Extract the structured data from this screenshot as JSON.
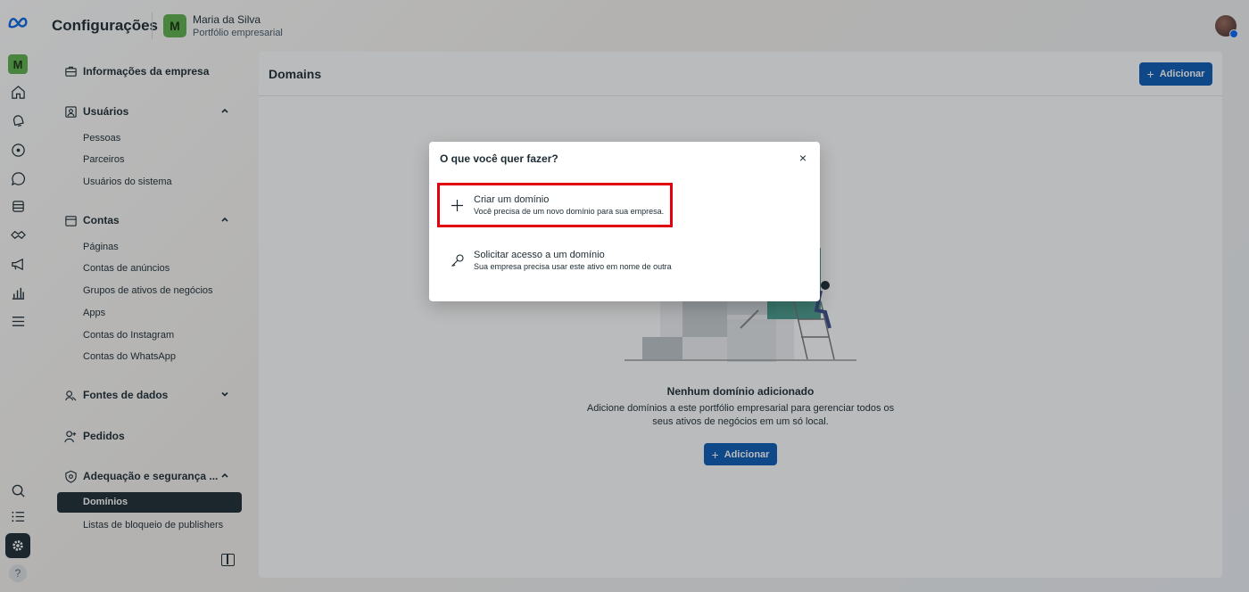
{
  "topbar": {
    "title": "Configurações",
    "business_initial": "M",
    "business_name": "Maria da Silva",
    "business_sub": "Portfólio empresarial"
  },
  "rail": {
    "badge_initial": "M",
    "help": "?"
  },
  "sidebar": {
    "company_info": "Informações da empresa",
    "users": {
      "label": "Usuários",
      "items": [
        "Pessoas",
        "Parceiros",
        "Usuários do sistema"
      ]
    },
    "accounts": {
      "label": "Contas",
      "items": [
        "Páginas",
        "Contas de anúncios",
        "Grupos de ativos de negócios",
        "Apps",
        "Contas do Instagram",
        "Contas do WhatsApp"
      ]
    },
    "data_sources": "Fontes de dados",
    "requests": "Pedidos",
    "brand_safety": {
      "label": "Adequação e segurança ...",
      "items": [
        "Domínios",
        "Listas de bloqueio de publishers"
      ]
    }
  },
  "main": {
    "title": "Domains",
    "add_label": "Adicionar",
    "empty_title": "Nenhum domínio adicionado",
    "empty_desc": "Adicione domínios a este portfólio empresarial para gerenciar todos os seus ativos de negócios em um só local.",
    "empty_add_label": "Adicionar"
  },
  "modal": {
    "title": "O que você quer fazer?",
    "close": "×",
    "options": [
      {
        "title": "Criar um domínio",
        "desc": "Você precisa de um novo domínio para sua empresa.",
        "icon": "plus-icon"
      },
      {
        "title": "Solicitar acesso a um domínio",
        "desc": "Sua empresa precisa usar este ativo em nome de outra",
        "icon": "key-icon"
      }
    ]
  },
  "colors": {
    "primary_button": "#0a5bb5",
    "highlight_border": "#e0000e",
    "active_nav": "#1c2b33",
    "business_green": "#5fb24e"
  }
}
